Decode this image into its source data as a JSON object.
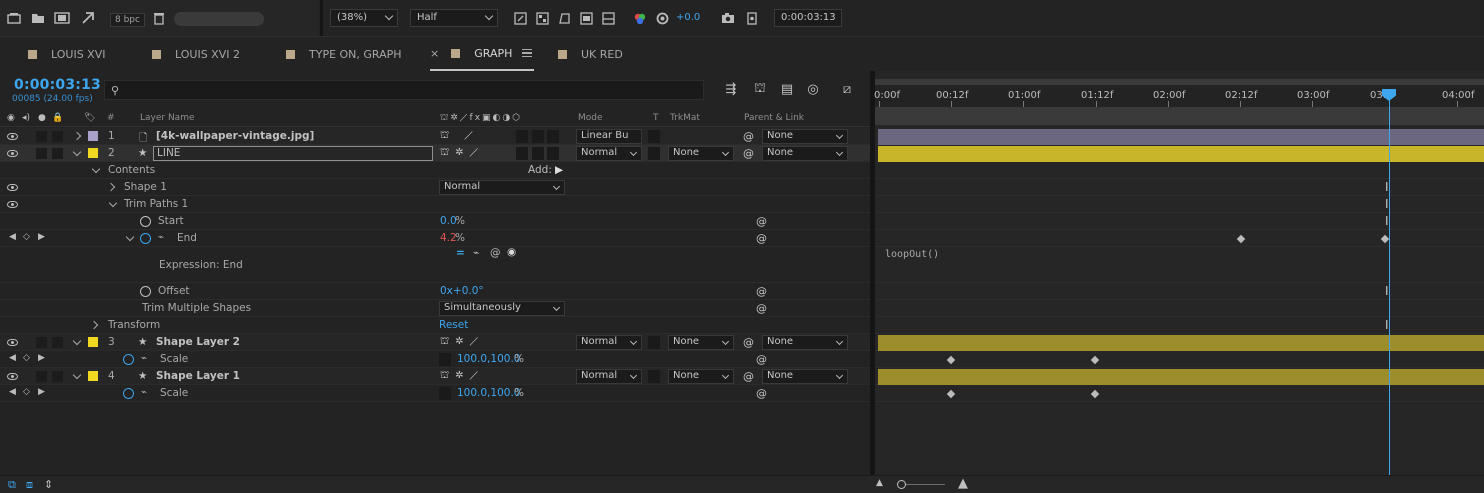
{
  "toolbar": {
    "bpc": "8 bpc",
    "zoom": "(38%)",
    "resolution": "Half",
    "exposure": "+0.0",
    "timecode": "0:00:03:13"
  },
  "tabs": [
    {
      "label": "LOUIS XVI"
    },
    {
      "label": "LOUIS XVI 2"
    },
    {
      "label": "TYPE ON, GRAPH"
    },
    {
      "label": "GRAPH"
    },
    {
      "label": "UK RED"
    }
  ],
  "comp": {
    "timecode": "0:00:03:13",
    "frame_info": "00085 (24.00 fps)",
    "search_placeholder": ""
  },
  "columns": {
    "hash": "#",
    "layer_name": "Layer Name",
    "mode": "Mode",
    "t": "T",
    "trkmat": "TrkMat",
    "parent": "Parent & Link"
  },
  "rows": {
    "l1": {
      "num": "1",
      "name": "[4k-wallpaper-vintage.jpg]",
      "mode": "Linear Bu",
      "parent": "None"
    },
    "l2": {
      "num": "2",
      "name": "LINE",
      "mode": "Normal",
      "trkmat": "None",
      "parent": "None"
    },
    "contents": {
      "label": "Contents",
      "add": "Add:"
    },
    "shape1": {
      "label": "Shape 1",
      "mode": "Normal"
    },
    "trim": {
      "label": "Trim Paths 1"
    },
    "start": {
      "label": "Start",
      "value": "0.0",
      "unit": "%"
    },
    "end": {
      "label": "End",
      "value": "4.2",
      "unit": "%"
    },
    "expr": {
      "label": "Expression: End"
    },
    "offset": {
      "label": "Offset",
      "value": "0x+0.0°"
    },
    "tms": {
      "label": "Trim Multiple Shapes",
      "value": "Simultaneously"
    },
    "transform": {
      "label": "Transform",
      "value": "Reset"
    },
    "l3": {
      "num": "3",
      "name": "Shape Layer 2",
      "mode": "Normal",
      "trkmat": "None",
      "parent": "None"
    },
    "scale3": {
      "label": "Scale",
      "value": "100.0,100.0",
      "unit": "%"
    },
    "l4": {
      "num": "4",
      "name": "Shape Layer 1",
      "mode": "Normal",
      "trkmat": "None",
      "parent": "None"
    },
    "scale4": {
      "label": "Scale",
      "value": "100.0,100.0",
      "unit": "%"
    }
  },
  "timeline": {
    "ticks": [
      "0:00f",
      "00:12f",
      "01:00f",
      "01:12f",
      "02:00f",
      "02:12f",
      "03:00f",
      "03:",
      "04:00f"
    ],
    "expression": "loopOut()"
  },
  "colors": {
    "accent": "#3da6ee",
    "label_lavender": "#a9a0c9",
    "label_yellow": "#f0d820",
    "bar_yellow": "#c9b52a",
    "bar_olive": "#9e8d2c",
    "bar_lavender": "#6c6780",
    "tab_swatch": "#bba78a"
  }
}
